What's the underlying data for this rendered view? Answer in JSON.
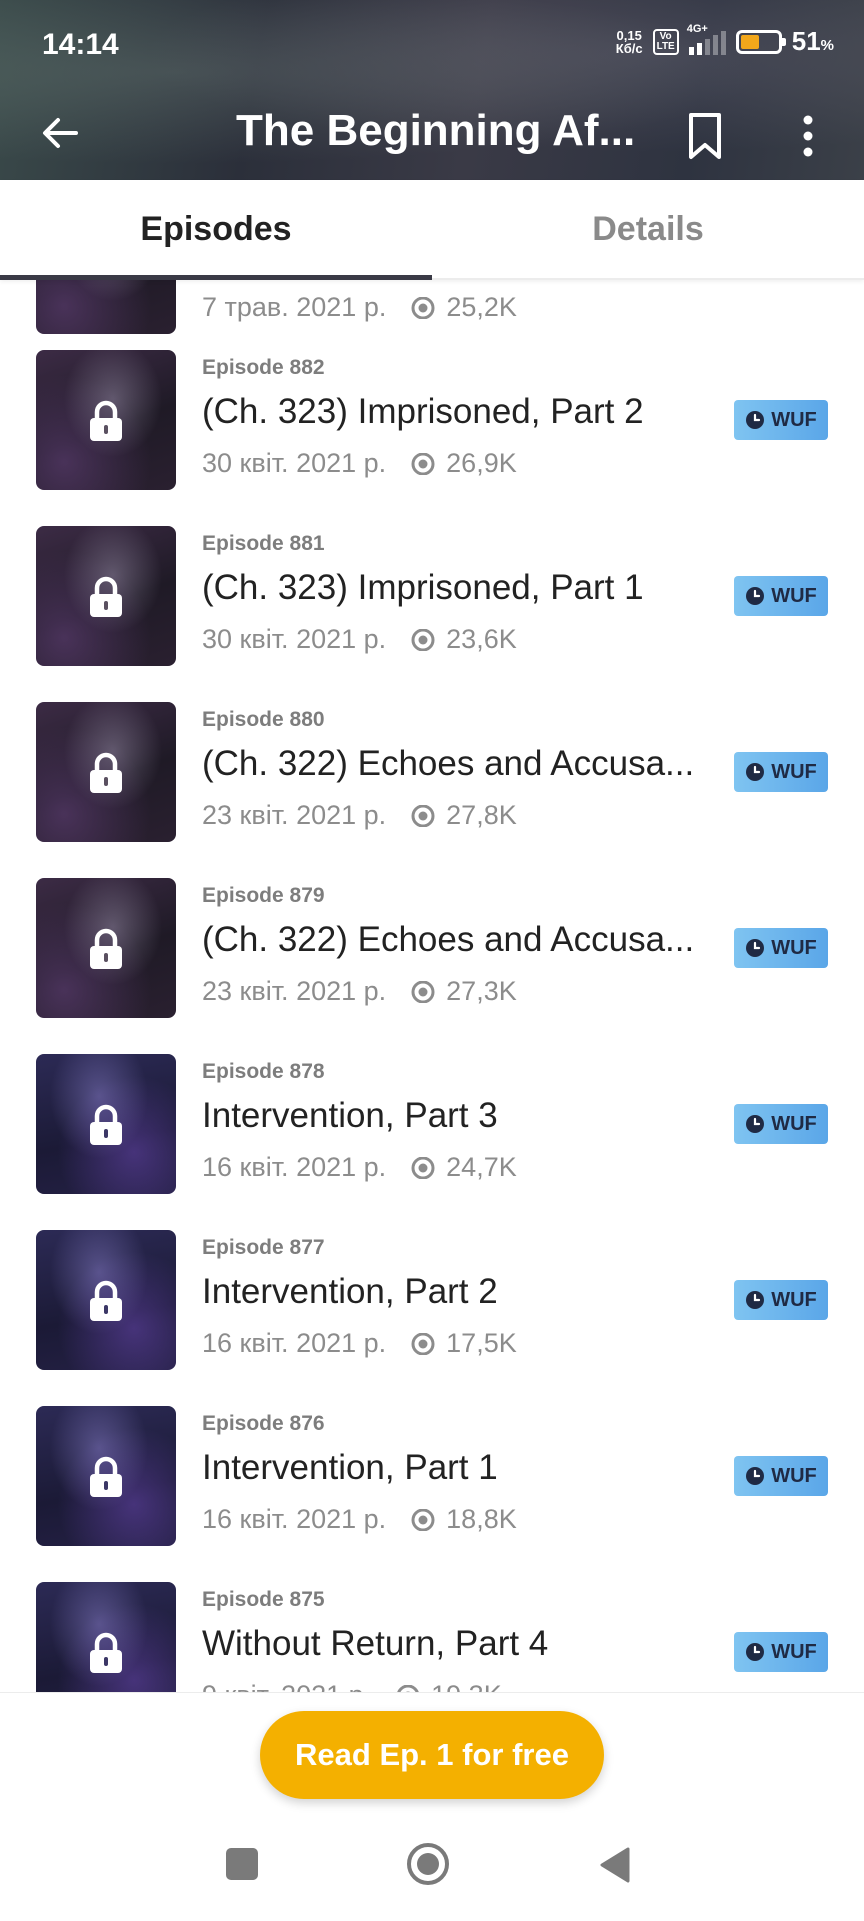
{
  "status_bar": {
    "time": "14:14",
    "net_speed_value": "0,15",
    "net_speed_unit": "Кб/с",
    "volte_top": "Vo",
    "volte_bottom": "LTE",
    "network": "4G+",
    "battery_level": 0.51,
    "battery_percent": "51",
    "battery_symbol": "%"
  },
  "header": {
    "title": "The Beginning Af...",
    "icons": [
      "arrow-left-icon",
      "bookmark-icon",
      "more-vertical-icon"
    ]
  },
  "tabs": [
    {
      "label": "Episodes",
      "active": true
    },
    {
      "label": "Details",
      "active": false
    }
  ],
  "episodes": [
    {
      "number": "",
      "title": "",
      "date": "7 трав. 2021 р.",
      "views": "25,2K",
      "badge": ""
    },
    {
      "number": "Episode 882",
      "title": "(Ch. 323) Imprisoned, Part 2",
      "date": "30 квіт. 2021 р.",
      "views": "26,9K",
      "badge": "WUF"
    },
    {
      "number": "Episode 881",
      "title": "(Ch. 323) Imprisoned, Part 1",
      "date": "30 квіт. 2021 р.",
      "views": "23,6K",
      "badge": "WUF"
    },
    {
      "number": "Episode 880",
      "title": "(Ch. 322) Echoes and Accusa...",
      "date": "23 квіт. 2021 р.",
      "views": "27,8K",
      "badge": "WUF"
    },
    {
      "number": "Episode 879",
      "title": "(Ch. 322) Echoes and Accusa...",
      "date": "23 квіт. 2021 р.",
      "views": "27,3K",
      "badge": "WUF"
    },
    {
      "number": "Episode 878",
      "title": "Intervention, Part 3",
      "date": "16 квіт. 2021 р.",
      "views": "24,7K",
      "badge": "WUF"
    },
    {
      "number": "Episode 877",
      "title": "Intervention, Part 2",
      "date": "16 квіт. 2021 р.",
      "views": "17,5K",
      "badge": "WUF"
    },
    {
      "number": "Episode 876",
      "title": "Intervention, Part 1",
      "date": "16 квіт. 2021 р.",
      "views": "18,8K",
      "badge": "WUF"
    },
    {
      "number": "Episode 875",
      "title": "Without Return, Part 4",
      "date": "9 квіт. 2021 р.",
      "views": "19,3K",
      "badge": "WUF"
    }
  ],
  "cta": {
    "label": "Read Ep. 1 for free",
    "color": "#f4b000"
  },
  "colors": {
    "badge": "#6bb6ee",
    "accent": "#f4b000",
    "tab_indicator": "#3a3a46"
  },
  "nav_bar": {
    "icons": [
      "recents-square-icon",
      "home-circle-icon",
      "back-triangle-icon"
    ]
  }
}
